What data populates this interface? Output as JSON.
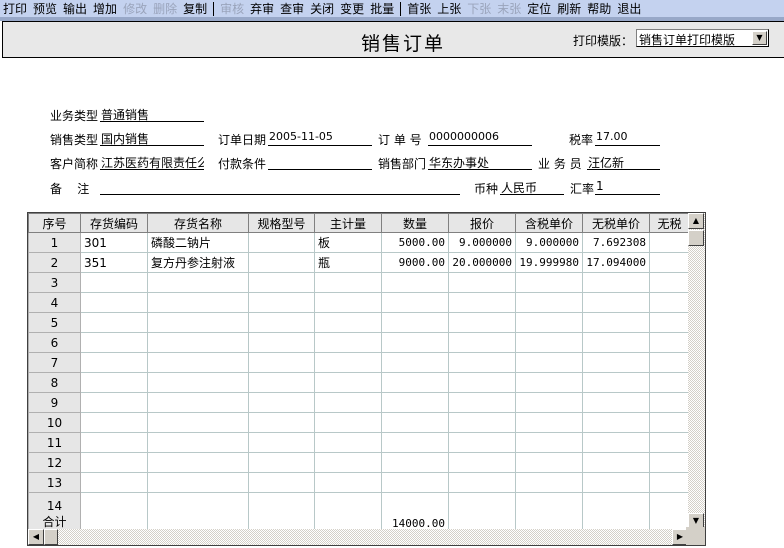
{
  "toolbar": {
    "items": [
      {
        "label": "打印",
        "enabled": true
      },
      {
        "label": "预览",
        "enabled": true
      },
      {
        "label": "输出",
        "enabled": true
      },
      {
        "label": "增加",
        "enabled": true
      },
      {
        "label": "修改",
        "enabled": false
      },
      {
        "label": "删除",
        "enabled": false
      },
      {
        "label": "复制",
        "enabled": true
      },
      {
        "label": "审核",
        "enabled": false
      },
      {
        "label": "弃审",
        "enabled": true
      },
      {
        "label": "查审",
        "enabled": true
      },
      {
        "label": "关闭",
        "enabled": true
      },
      {
        "label": "变更",
        "enabled": true
      },
      {
        "label": "批量",
        "enabled": true
      },
      {
        "label": "首张",
        "enabled": true
      },
      {
        "label": "上张",
        "enabled": true
      },
      {
        "label": "下张",
        "enabled": false
      },
      {
        "label": "末张",
        "enabled": false
      },
      {
        "label": "定位",
        "enabled": true
      },
      {
        "label": "刷新",
        "enabled": true
      },
      {
        "label": "帮助",
        "enabled": true
      },
      {
        "label": "退出",
        "enabled": true
      }
    ]
  },
  "header": {
    "title": "销售订单",
    "template_label": "打印模版：",
    "template_value": "销售订单打印模版"
  },
  "form": {
    "biz_type": {
      "label": "业务类型",
      "value": "普通销售"
    },
    "sales_type": {
      "label": "销售类型",
      "value": "国内销售"
    },
    "order_date": {
      "label": "订单日期",
      "value": "2005-11-05"
    },
    "order_no": {
      "label": "订 单 号",
      "value": "0000000006"
    },
    "tax_rate": {
      "label": "税率",
      "value": "17.00"
    },
    "customer": {
      "label": "客户简称",
      "value": "江苏医药有限责任么"
    },
    "payment": {
      "label": "付款条件",
      "value": ""
    },
    "dept": {
      "label": "销售部门",
      "value": "华东办事处"
    },
    "salesman": {
      "label": "业 务 员",
      "value": "汪亿新"
    },
    "remark": {
      "label": "备    注",
      "value": ""
    },
    "currency": {
      "label": "币种",
      "value": "人民币"
    },
    "exchange": {
      "label": "汇率",
      "value": "1"
    }
  },
  "grid": {
    "columns": [
      "序号",
      "存货编码",
      "存货名称",
      "规格型号",
      "主计量",
      "数量",
      "报价",
      "含税单价",
      "无税单价",
      "无税"
    ],
    "rows": [
      [
        "1",
        "301",
        "磷酸二钠片",
        "",
        "板",
        "5000.00",
        "9.000000",
        "9.000000",
        "7.692308",
        ""
      ],
      [
        "2",
        "351",
        "复方丹参注射液",
        "",
        "瓶",
        "9000.00",
        "20.000000",
        "19.999980",
        "17.094000",
        ""
      ],
      [
        "3"
      ],
      [
        "4"
      ],
      [
        "5"
      ],
      [
        "6"
      ],
      [
        "7"
      ],
      [
        "8"
      ],
      [
        "9"
      ],
      [
        "10"
      ],
      [
        "11"
      ],
      [
        "12"
      ],
      [
        "13"
      ],
      [
        "14"
      ]
    ],
    "total_label": "合计",
    "total_qty": "14000.00"
  }
}
